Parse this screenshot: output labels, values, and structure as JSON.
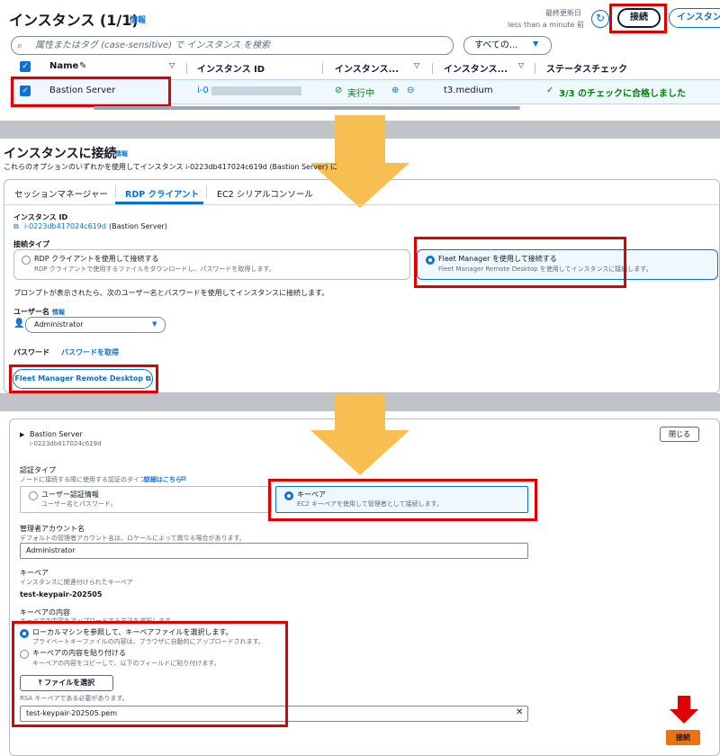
{
  "colors": {
    "highlight": "#e00000",
    "arrow": "#f7bf52",
    "link": "#0972d3",
    "primary": "#ec7211"
  },
  "s1": {
    "title": "インスタンス (1/1)",
    "info": "情報",
    "last_updated_label": "最終更新日",
    "last_updated_value": "less than a minute 前",
    "connect_button": "接続",
    "instance_button": "インスタンスを起動",
    "search_placeholder": "属性またはタグ (case-sensitive) で インスタンス を検索",
    "filter_value": "すべての...",
    "columns": [
      "Name",
      "インスタンス ID",
      "インスタンス...",
      "インスタンス...",
      "ステータスチェック"
    ],
    "row": {
      "name": "Bastion Server",
      "id_prefix": "i-0",
      "state": "実行中",
      "type": "t3.medium",
      "status": "3/3 のチェックに合格しました"
    }
  },
  "s2": {
    "title": "インスタンスに接続",
    "info": "情報",
    "description": "これらのオプションのいずれかを使用してインスタンス i-0223db417024c619d (Bastion Server) に",
    "tabs": [
      "セッションマネージャー",
      "RDP クライアント",
      "EC2 シリアルコンソール"
    ],
    "instance_id_label": "インスタンス ID",
    "instance_id_value": "i-0223db417024c619d",
    "instance_name": "(Bastion Server)",
    "conn_type_label": "接続タイプ",
    "opt_rdp_title": "RDP クライアントを使用して接続する",
    "opt_rdp_desc": "RDP クライアントで使用するファイルをダウンロードし、パスワードを取得します。",
    "opt_fm_title": "Fleet Manager を使用して接続する",
    "opt_fm_desc": "Fleet Manager Remote Desktop を使用してインスタンスに接続します。",
    "prompt_text": "プロンプトが表示されたら、次のユーザー名とパスワードを使用してインスタンスに接続します。",
    "username_label": "ユーザー名",
    "username_info": "情報",
    "username_value": "Administrator",
    "password_label": "パスワード",
    "password_link": "パスワードを取得",
    "fm_button": "Fleet Manager Remote Desktop"
  },
  "s3": {
    "server_name": "Bastion Server",
    "server_id": "i-0223db417024c619d",
    "close_button": "閉じる",
    "auth_label": "認証タイプ",
    "auth_desc": "ノードに接続する際に使用する認証のタイプ。",
    "auth_link": "詳細はこちら",
    "opt_user_title": "ユーザー認証情報",
    "opt_user_desc": "ユーザー名とパスワード。",
    "opt_key_title": "キーペア",
    "opt_key_desc": "EC2 キーペアを使用して管理者として接続します。",
    "admin_label": "管理者アカウント名",
    "admin_desc": "デフォルトの管理者アカウント名は、ロケールによって異なる場合があります。",
    "admin_value": "Administrator",
    "keypair_label": "キーペア",
    "keypair_desc": "インスタンスに関連付けられたキーペア",
    "keypair_value": "test-keypair-202505",
    "content_label": "キーペアの内容",
    "content_desc": "キーペアの内容をアップロードする方法を選択します。",
    "local_title": "ローカルマシンを参照して、キーペアファイルを選択します。",
    "local_desc": "プライベートキーファイルの内容は、ブラウザに自動的にアップロードされます。",
    "paste_title": "キーペアの内容を貼り付ける",
    "paste_desc": "キーペアの内容をコピーして、以下のフィールドに貼り付けます。",
    "file_button": "ファイルを選択",
    "rsa_note": "RSA キーペアである必要があります。",
    "file_value": "test-keypair-202505.pem",
    "connect_button": "接続"
  }
}
